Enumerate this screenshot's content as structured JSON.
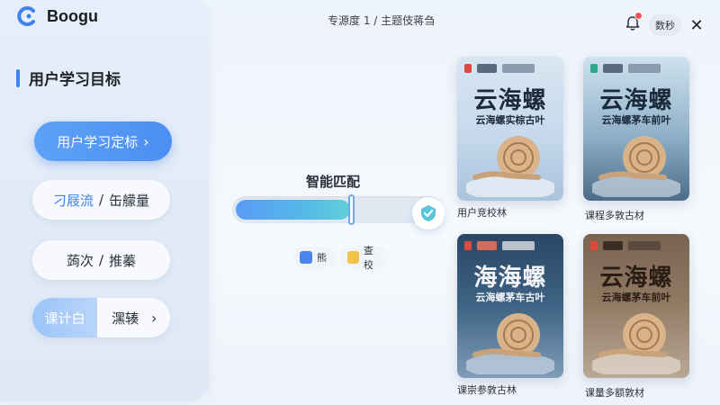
{
  "app": {
    "name": "Boogu"
  },
  "header": {
    "title": "专源度 1 / 主题伎蒋刍",
    "button_label": "数秒",
    "close_glyph": "✕"
  },
  "sidebar": {
    "section_title": "用户学习目标",
    "items": [
      {
        "label": "用户学习定标",
        "chevron": "›"
      },
      {
        "label_accent": "刁屐流",
        "separator": "/",
        "label_rest": "缶艨量"
      },
      {
        "label": "蒟次",
        "separator": "/",
        "label_rest": "推蓁"
      },
      {
        "label_left": "课计白",
        "label_right": "潶辏",
        "chevron": "›"
      }
    ]
  },
  "match": {
    "label": "智能匹配",
    "level": 0.56,
    "chips": [
      {
        "label": "熊",
        "icon": "blue-square-icon"
      },
      {
        "label": "查校",
        "icon": "yellow-square-icon"
      }
    ]
  },
  "cards": [
    {
      "title": "云海螺",
      "subtitle": "云海螺实棕古叶",
      "caption": "用户竞校林"
    },
    {
      "title": "云海螺",
      "subtitle": "云海螺茅车前叶",
      "caption": "课程多敦古材"
    },
    {
      "title": "海海螺",
      "subtitle": "云海螺茅车古叶",
      "caption": "课崇参敦古林"
    },
    {
      "title": "云海螺",
      "subtitle": "云海螺茅车前叶",
      "caption": "课量多额敦材"
    }
  ],
  "colors": {
    "accent": "#3d82ee",
    "sidebar_bg": "#e3ecf7",
    "fill_start": "#5a9cf5",
    "fill_end": "#5fd0d6"
  }
}
